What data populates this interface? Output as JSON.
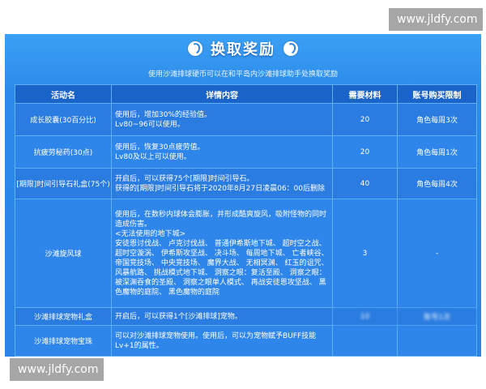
{
  "watermark": "www.jldfy.com",
  "title": "换取奖励",
  "subtitle": "使用沙滩排球硬币可以在和平岛内沙滩排球助手处换取奖励",
  "headers": [
    "活动名",
    "详情内容",
    "需要材料",
    "账号购买限制"
  ],
  "rows": [
    {
      "name": "成长胶囊(30百分比)",
      "details": [
        "使用后，增加30%的经验值。",
        "Lv80~96可以使用。"
      ],
      "material": "20",
      "limit": "角色每周3次"
    },
    {
      "name": "抗疲劳秘药(30点)",
      "details": [
        "使用后，恢复30点疲劳值。",
        "Lv80及以上可以使用。"
      ],
      "material": "20",
      "limit": "角色每周1次"
    },
    {
      "name": "[期限]时间引导石礼盒(75个)",
      "details": [
        "开启后，可以获得75个[期限]时间引导石。",
        "获得的[期限]时间引导石将于2020年8月27日凌晨06：00后删除"
      ],
      "material": "40",
      "limit": "角色每周4次"
    },
    {
      "name": "沙滩旋风球",
      "details": [
        "使用后，在数秒内球体会膨胀，并形成酷爽旋风，吸附怪物的同时",
        "造成伤害。",
        "<无法使用的地下城>",
        "安徒恩讨伐战、 卢克讨伐战、 普通伊希斯地下城、 超时空之战、",
        "超时空漩涡、 伊希斯攻坚战、 决斗场、 每周地下城、 亡者峡谷、",
        "帝国竞技场、 中央竞技场、 魔界大战、 无相冥渊、 红玉的诅咒、",
        "风暴航路、 挑战模式地下城、 洞察之眼：复活至殿、 洞察之眼：",
        "被深渊吞食的圣殿、 洞察之眼单人模式、 再战安徒恩攻坚战、 黑",
        "色魔物的庭院、 黑色魔物的庭院"
      ],
      "material": "3",
      "limit": "-"
    },
    {
      "name": "沙滩排球宠物礼盒",
      "details": [
        "开启后，可以获得1个[沙滩排球]宠物。"
      ],
      "material": "10",
      "limit": "账号1次"
    },
    {
      "name": "沙滩排球宠物宝珠",
      "details": [
        "可以对沙滩排球宠物使用。使用后，可以为宠物赋予BUFF技能",
        "Lv+1的属性。"
      ],
      "material": "",
      "limit": ""
    }
  ]
}
